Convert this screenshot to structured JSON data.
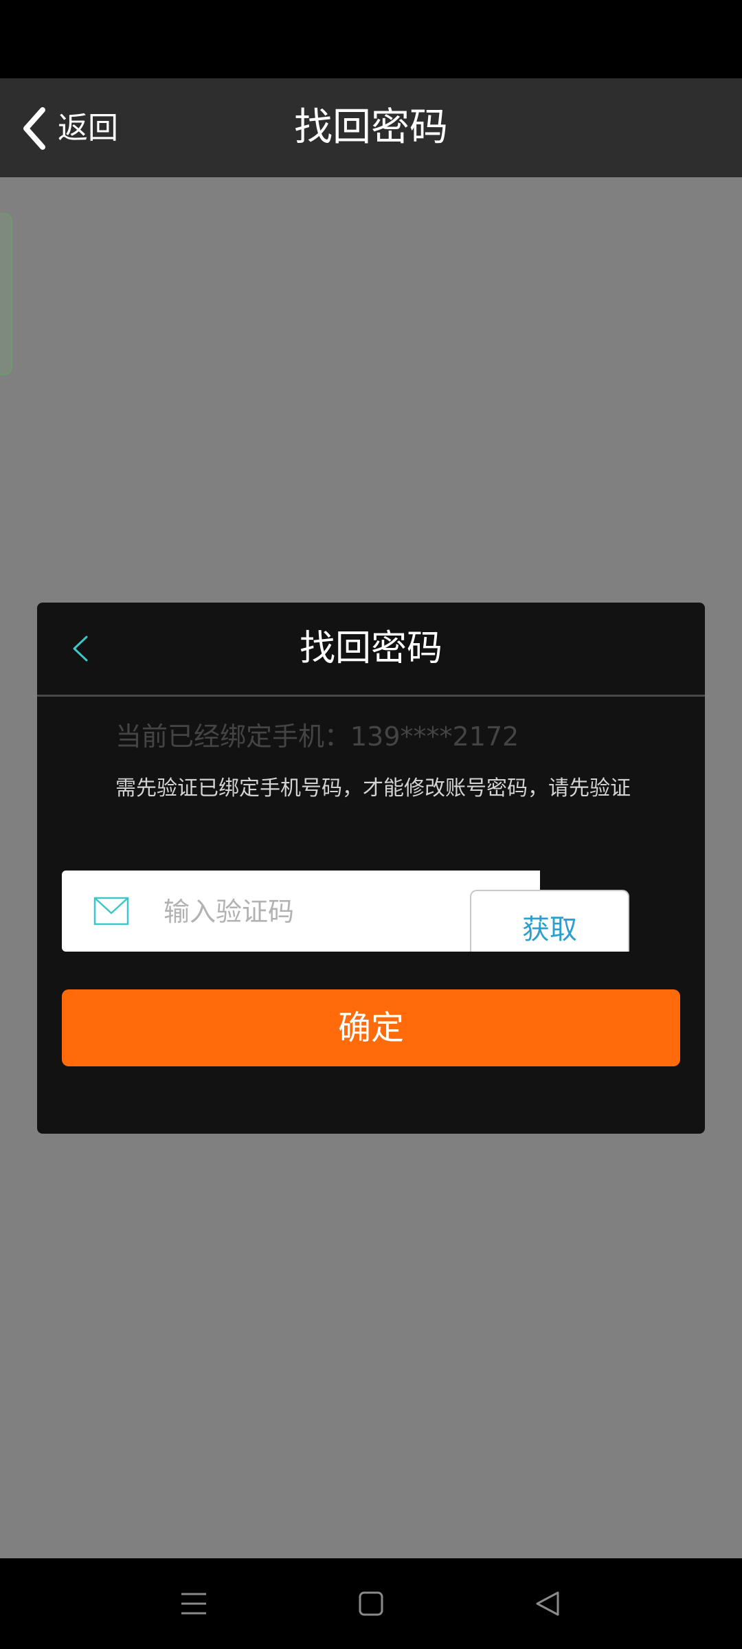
{
  "header": {
    "back_label": "返回",
    "title": "找回密码"
  },
  "dialog": {
    "title": "找回密码",
    "bound_phone_text": "当前已经绑定手机：139****2172",
    "notice": "需先验证已绑定手机号码，才能修改账号密码，请先验证",
    "code_input": {
      "placeholder": "输入验证码",
      "value": ""
    },
    "get_code_label": "获取",
    "confirm_label": "确定"
  },
  "icons": {
    "back": "chevron-left-icon",
    "dialog_back": "chevron-left-icon",
    "mail": "mail-icon",
    "nav_menu": "menu-icon",
    "nav_home": "square-home-icon",
    "nav_back": "triangle-back-icon"
  },
  "colors": {
    "accent_orange": "#ff6a0a",
    "link_blue": "#2d9fcf",
    "icon_teal": "#3cc6c6",
    "header_bg": "#2e2e2e",
    "dim_overlay": "#808080",
    "dialog_bg": "#121212"
  }
}
